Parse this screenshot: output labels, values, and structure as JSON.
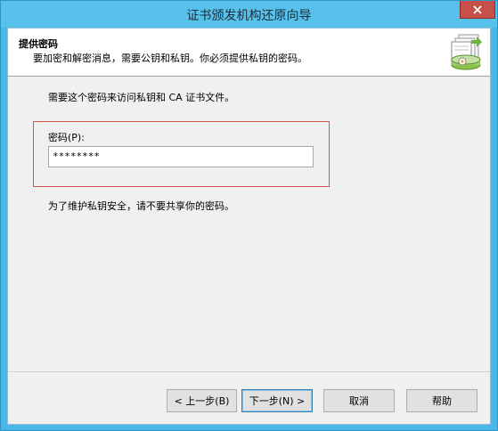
{
  "window": {
    "title": "证书颁发机构还原向导"
  },
  "header": {
    "title": "提供密码",
    "subtitle": "要加密和解密消息，需要公钥和私钥。你必须提供私钥的密码。"
  },
  "main": {
    "intro": "需要这个密码来访问私钥和 CA 证书文件。",
    "password_label": "密码(P):",
    "password_value": "********",
    "note": "为了维护私钥安全，请不要共享你的密码。"
  },
  "buttons": {
    "back": "< 上一步(B)",
    "next": "下一步(N) >",
    "cancel": "取消",
    "help": "帮助"
  },
  "icons": {
    "close": "close-icon",
    "wizard": "certificate-wizard-icon"
  },
  "colors": {
    "titlebar": "#57c1ec",
    "highlight": "#d9534f",
    "close": "#c7504b"
  }
}
